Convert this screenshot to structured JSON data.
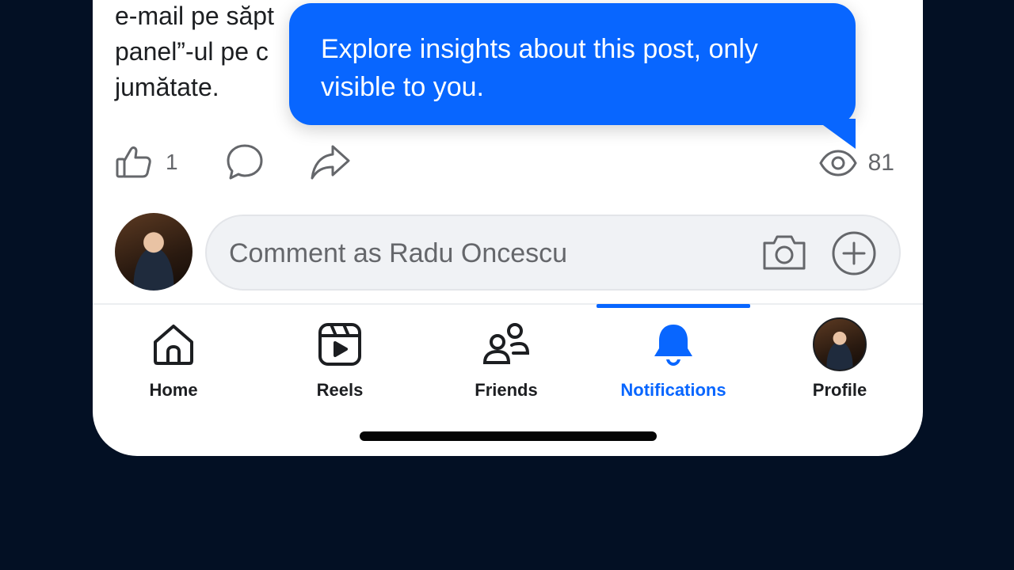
{
  "post": {
    "lines": [
      "e-mail pe săpt",
      "panel”-ul pe c",
      "jumătate."
    ]
  },
  "tooltip": {
    "lines": [
      "Explore insights about this post, only",
      "visible to you."
    ]
  },
  "actions": {
    "like_count": "1",
    "views_count": "81"
  },
  "comment": {
    "placeholder": "Comment as Radu Oncescu"
  },
  "nav": {
    "items": [
      {
        "label": "Home",
        "icon": "home-icon"
      },
      {
        "label": "Reels",
        "icon": "reels-icon"
      },
      {
        "label": "Friends",
        "icon": "friends-icon"
      },
      {
        "label": "Notifications",
        "icon": "bell-icon",
        "active": true
      },
      {
        "label": "Profile",
        "icon": "profile-avatar"
      }
    ]
  },
  "colors": {
    "background": "#031024",
    "accent": "#0866ff",
    "text": "#1c1e21",
    "secondary_text": "#65676b"
  }
}
